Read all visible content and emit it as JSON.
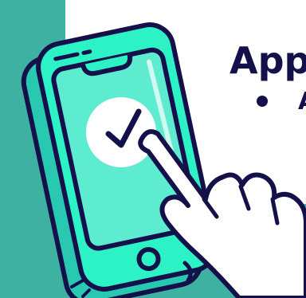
{
  "slide": {
    "title": "App",
    "bullets": [
      {
        "text": "A"
      }
    ]
  },
  "colors": {
    "teal_panel": "#3fb1a3",
    "bright_teal": "#2df2c6",
    "navy": "#13104a",
    "phone_body": "#2ed3b5",
    "screen": "#5eecd0",
    "white": "#ffffff"
  },
  "icons": {
    "check": "check-icon",
    "hand": "pointing-hand-icon",
    "phone": "smartphone-icon"
  }
}
